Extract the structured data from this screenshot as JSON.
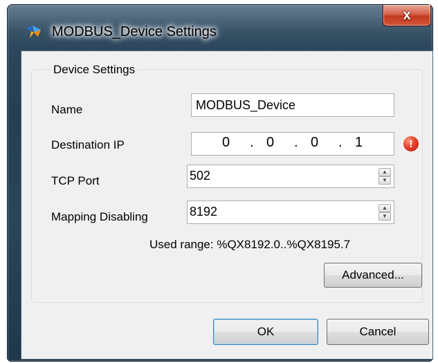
{
  "window": {
    "title": "MODBUS_Device Settings",
    "close_glyph": "x",
    "app_icon": "modbus-app-icon"
  },
  "group": {
    "label": "Device Settings"
  },
  "fields": {
    "name": {
      "label": "Name",
      "value": "MODBUS_Device"
    },
    "destination_ip": {
      "label": "Destination IP",
      "octets": [
        "0",
        "0",
        "0",
        "1"
      ],
      "separator": ".",
      "error_icon": "error-icon",
      "error_glyph": "!"
    },
    "tcp_port": {
      "label": "TCP Port",
      "value": "502"
    },
    "mapping_disabling": {
      "label": "Mapping Disabling",
      "value": "8192"
    }
  },
  "used_range": "Used range: %QX8192.0..%QX8195.7",
  "buttons": {
    "advanced": "Advanced...",
    "ok": "OK",
    "cancel": "Cancel"
  },
  "spinner": {
    "up": "▲",
    "down": "▼"
  },
  "colors": {
    "close_button": "#c23a1f",
    "error_icon": "#e2412a",
    "default_button_border": "#3c7fb1"
  }
}
